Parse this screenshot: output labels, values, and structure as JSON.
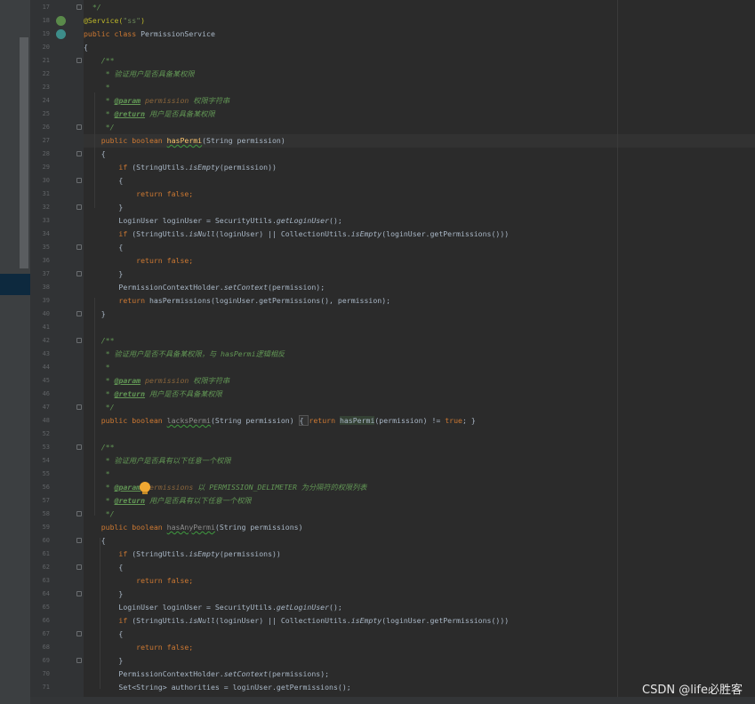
{
  "lines": [
    {
      "n": "17",
      "parts": [
        [
          "  */",
          "cmt"
        ]
      ]
    },
    {
      "n": "18",
      "parts": [
        [
          "@Service(",
          "ann"
        ],
        [
          "\"ss\"",
          "str"
        ],
        [
          ")",
          "ann"
        ]
      ]
    },
    {
      "n": "19",
      "parts": [
        [
          "public class ",
          "kw"
        ],
        [
          "PermissionService",
          ""
        ]
      ]
    },
    {
      "n": "20",
      "parts": [
        [
          "{",
          ""
        ]
      ]
    },
    {
      "n": "21",
      "parts": [
        [
          "    /**",
          "cmt"
        ]
      ]
    },
    {
      "n": "22",
      "parts": [
        [
          "     * 验证用户是否具备某权限",
          "cmt"
        ]
      ]
    },
    {
      "n": "23",
      "parts": [
        [
          "     *",
          "cmt"
        ]
      ]
    },
    {
      "n": "24",
      "parts": [
        [
          "     * ",
          "cmt"
        ],
        [
          "@param",
          "tag"
        ],
        [
          " permission",
          "tagarg"
        ],
        [
          " 权限字符串",
          "cmt"
        ]
      ]
    },
    {
      "n": "25",
      "parts": [
        [
          "     * ",
          "cmt"
        ],
        [
          "@return",
          "tag"
        ],
        [
          " 用户是否具备某权限",
          "cmt"
        ]
      ]
    },
    {
      "n": "26",
      "parts": [
        [
          "     */",
          "cmt"
        ]
      ]
    },
    {
      "n": "27",
      "parts": [
        [
          "    public boolean ",
          "kw"
        ],
        [
          "hasPermi",
          "fn wavy"
        ],
        [
          "(String permission)",
          ""
        ]
      ]
    },
    {
      "n": "28",
      "parts": [
        [
          "    {",
          ""
        ]
      ]
    },
    {
      "n": "29",
      "parts": [
        [
          "        if ",
          "kw"
        ],
        [
          "(StringUtils.",
          ""
        ],
        [
          "isEmpty",
          "sm"
        ],
        [
          "(permission))",
          ""
        ]
      ]
    },
    {
      "n": "30",
      "parts": [
        [
          "        {",
          ""
        ]
      ]
    },
    {
      "n": "31",
      "parts": [
        [
          "            return false;",
          "kw"
        ]
      ]
    },
    {
      "n": "32",
      "parts": [
        [
          "        }",
          ""
        ]
      ]
    },
    {
      "n": "33",
      "parts": [
        [
          "        LoginUser loginUser = SecurityUtils.",
          ""
        ],
        [
          "getLoginUser",
          "sm"
        ],
        [
          "();",
          ""
        ]
      ]
    },
    {
      "n": "34",
      "parts": [
        [
          "        if ",
          "kw"
        ],
        [
          "(StringUtils.",
          ""
        ],
        [
          "isNull",
          "sm"
        ],
        [
          "(loginUser) || CollectionUtils.",
          ""
        ],
        [
          "isEmpty",
          "sm"
        ],
        [
          "(loginUser.getPermissions()))",
          ""
        ]
      ]
    },
    {
      "n": "35",
      "parts": [
        [
          "        {",
          ""
        ]
      ]
    },
    {
      "n": "36",
      "parts": [
        [
          "            return false;",
          "kw"
        ]
      ]
    },
    {
      "n": "37",
      "parts": [
        [
          "        }",
          ""
        ]
      ]
    },
    {
      "n": "38",
      "parts": [
        [
          "        PermissionContextHolder.",
          ""
        ],
        [
          "setContext",
          "sm"
        ],
        [
          "(permission);",
          ""
        ]
      ]
    },
    {
      "n": "39",
      "parts": [
        [
          "        return ",
          "kw"
        ],
        [
          "hasPermissions(loginUser.getPermissions(), permission);",
          ""
        ]
      ]
    },
    {
      "n": "40",
      "parts": [
        [
          "    }",
          ""
        ]
      ]
    },
    {
      "n": "41",
      "parts": [
        [
          "",
          ""
        ]
      ]
    },
    {
      "n": "42",
      "parts": [
        [
          "    /**",
          "cmt"
        ]
      ]
    },
    {
      "n": "43",
      "parts": [
        [
          "     * 验证用户是否不具备某权限，与 hasPermi逻辑相反",
          "cmt"
        ]
      ]
    },
    {
      "n": "44",
      "parts": [
        [
          "     *",
          "cmt"
        ]
      ]
    },
    {
      "n": "45",
      "parts": [
        [
          "     * ",
          "cmt"
        ],
        [
          "@param",
          "tag"
        ],
        [
          " permission",
          "tagarg"
        ],
        [
          " 权限字符串",
          "cmt"
        ]
      ]
    },
    {
      "n": "46",
      "parts": [
        [
          "     * ",
          "cmt"
        ],
        [
          "@return",
          "tag"
        ],
        [
          " 用户是否不具备某权限",
          "cmt"
        ]
      ]
    },
    {
      "n": "47",
      "parts": [
        [
          "     */",
          "cmt"
        ]
      ]
    },
    {
      "n": "48",
      "parts": [
        [
          "    public boolean ",
          "kw"
        ],
        [
          "lacksPermi",
          "unused wavy"
        ],
        [
          "(String permission) ",
          ""
        ],
        [
          "{ ",
          "fold-hl"
        ],
        [
          "return ",
          "kw"
        ],
        [
          "hasPermi",
          "hl"
        ],
        [
          "(permission) != ",
          ""
        ],
        [
          "true",
          "kw"
        ],
        [
          "; }",
          ""
        ]
      ]
    },
    {
      "n": "52",
      "parts": [
        [
          "",
          ""
        ]
      ]
    },
    {
      "n": "53",
      "parts": [
        [
          "    /**",
          "cmt"
        ]
      ]
    },
    {
      "n": "54",
      "parts": [
        [
          "     * 验证用户是否具有以下任意一个权限",
          "cmt"
        ]
      ]
    },
    {
      "n": "55",
      "parts": [
        [
          "     *",
          "cmt"
        ]
      ]
    },
    {
      "n": "56",
      "parts": [
        [
          "     * ",
          "cmt"
        ],
        [
          "@param",
          "tag"
        ],
        [
          " permissions",
          "tagarg"
        ],
        [
          " 以 PERMISSION_DELIMETER 为分隔符的权限列表",
          "cmt"
        ]
      ]
    },
    {
      "n": "57",
      "parts": [
        [
          "     * ",
          "cmt"
        ],
        [
          "@return",
          "tag"
        ],
        [
          " 用户是否具有以下任意一个权限",
          "cmt"
        ]
      ]
    },
    {
      "n": "58",
      "parts": [
        [
          "     */",
          "cmt"
        ]
      ]
    },
    {
      "n": "59",
      "parts": [
        [
          "    public boolean ",
          "kw"
        ],
        [
          "hasAnyPermi",
          "unused wavy"
        ],
        [
          "(String permissions)",
          ""
        ]
      ]
    },
    {
      "n": "60",
      "parts": [
        [
          "    {",
          ""
        ]
      ]
    },
    {
      "n": "61",
      "parts": [
        [
          "        if ",
          "kw"
        ],
        [
          "(StringUtils.",
          ""
        ],
        [
          "isEmpty",
          "sm"
        ],
        [
          "(permissions))",
          ""
        ]
      ]
    },
    {
      "n": "62",
      "parts": [
        [
          "        {",
          ""
        ]
      ]
    },
    {
      "n": "63",
      "parts": [
        [
          "            return false;",
          "kw"
        ]
      ]
    },
    {
      "n": "64",
      "parts": [
        [
          "        }",
          ""
        ]
      ]
    },
    {
      "n": "65",
      "parts": [
        [
          "        LoginUser loginUser = SecurityUtils.",
          ""
        ],
        [
          "getLoginUser",
          "sm"
        ],
        [
          "();",
          ""
        ]
      ]
    },
    {
      "n": "66",
      "parts": [
        [
          "        if ",
          "kw"
        ],
        [
          "(StringUtils.",
          ""
        ],
        [
          "isNull",
          "sm"
        ],
        [
          "(loginUser) || CollectionUtils.",
          ""
        ],
        [
          "isEmpty",
          "sm"
        ],
        [
          "(loginUser.getPermissions()))",
          ""
        ]
      ]
    },
    {
      "n": "67",
      "parts": [
        [
          "        {",
          ""
        ]
      ]
    },
    {
      "n": "68",
      "parts": [
        [
          "            return false;",
          "kw"
        ]
      ]
    },
    {
      "n": "69",
      "parts": [
        [
          "        }",
          ""
        ]
      ]
    },
    {
      "n": "70",
      "parts": [
        [
          "        PermissionContextHolder.",
          ""
        ],
        [
          "setContext",
          "sm"
        ],
        [
          "(permissions);",
          ""
        ]
      ]
    },
    {
      "n": "71",
      "parts": [
        [
          "        Set<String> authorities = loginUser.getPermissions();",
          ""
        ]
      ]
    }
  ],
  "caret_line": "27",
  "watermark": "CSDN @life必胜客"
}
